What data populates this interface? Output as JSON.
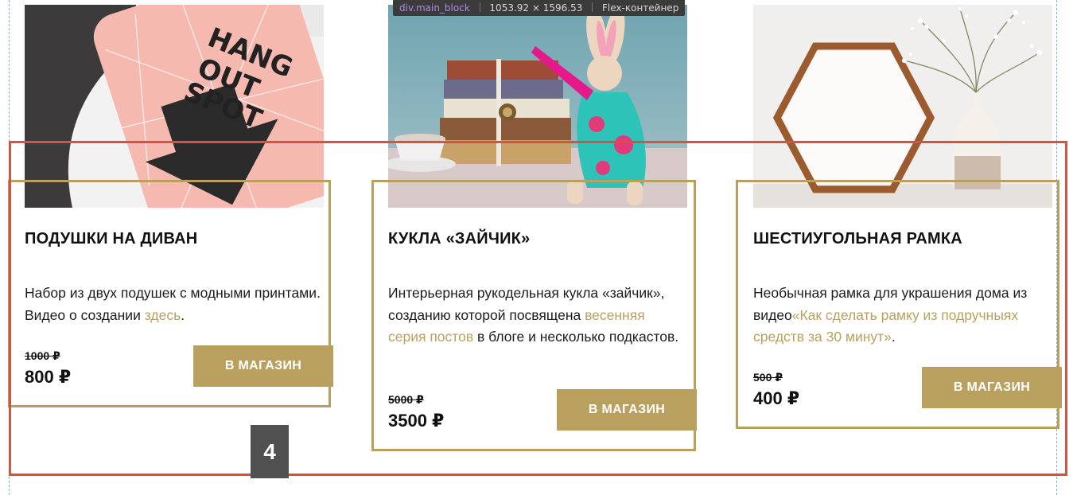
{
  "devtools": {
    "selector_tag": "div",
    "selector_class": ".main_block",
    "size": "1053.92 × 1596.53",
    "layout": "Flex-контейнер"
  },
  "products": [
    {
      "image": "pink-pillow-hang-out-spot-photo",
      "image_text": [
        "HANG",
        "OUT",
        "SPOT"
      ],
      "title": "ПОДУШКИ НА ДИВАН",
      "desc_before": "Набор из двух подушек с модными принтами. Видео о создании ",
      "desc_link": "здесь",
      "desc_after": ".",
      "price_old": "1000 ₽",
      "price_new": "800 ₽",
      "button": "В МАГАЗИН"
    },
    {
      "image": "bunny-doll-with-books-photo",
      "title": "КУКЛА «ЗАЙЧИК»",
      "desc_before": "Интерьерная рукодельная кукла «зайчик», созданию которой посвящена ",
      "desc_link": "весенняя серия постов",
      "desc_after": " в блоге и несколько подкастов.",
      "price_old": "5000 ₽",
      "price_new": "3500 ₽",
      "button": "В МАГАЗИН"
    },
    {
      "image": "hexagon-frame-and-vase-photo",
      "title": "ШЕСТИУГОЛЬНАЯ РАМКА",
      "desc_before": "Необычная рамка для украшения дома из видео",
      "desc_link": "«Как сделать рамку из подручныях средств за 30 минут»",
      "desc_after": ".",
      "price_old": "500 ₽",
      "price_new": "400 ₽",
      "button": "В МАГАЗИН"
    }
  ],
  "badge": "4",
  "colors": {
    "accent": "#b9a05e",
    "highlight_outline": "#d6543f",
    "badge_bg": "#505050"
  }
}
